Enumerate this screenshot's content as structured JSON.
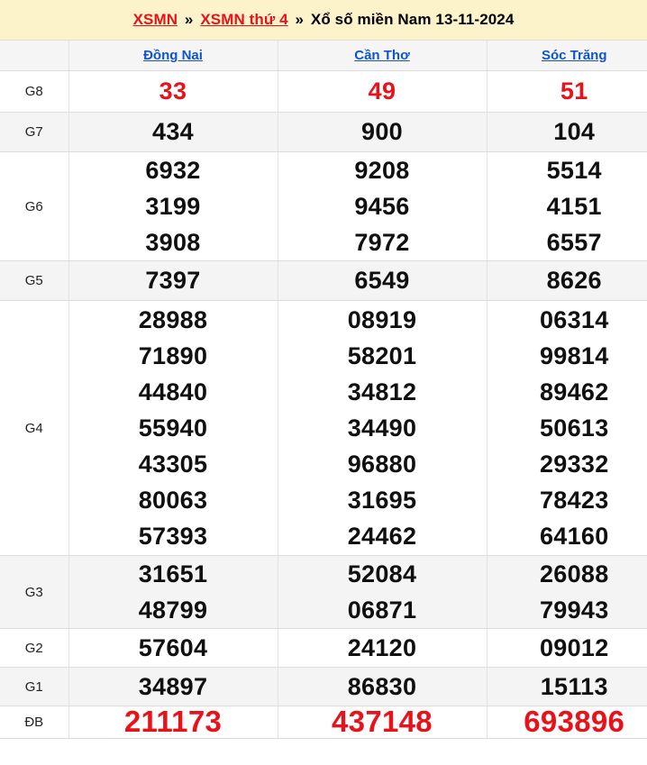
{
  "breadcrumb": {
    "link1": "XSMN",
    "sep1": "»",
    "link2": "XSMN thứ 4",
    "sep2": "»",
    "current": "Xổ số miền Nam 13-11-2024"
  },
  "colors": {
    "header_bg": "#fcf3ca",
    "crumb_link": "#e8121a",
    "province_link": "#1155cc",
    "special_red": "#e8121a",
    "row_grey": "#f4f4f4",
    "row_white": "#ffffff"
  },
  "table": {
    "corner_label": "",
    "columns": [
      "Đồng Nai",
      "Cần Thơ",
      "Sóc Trăng"
    ],
    "rows": [
      {
        "label": "G8",
        "band": "white",
        "style": "red",
        "values": [
          [
            "33"
          ],
          [
            "49"
          ],
          [
            "51"
          ]
        ]
      },
      {
        "label": "G7",
        "band": "grey",
        "style": "normal",
        "values": [
          [
            "434"
          ],
          [
            "900"
          ],
          [
            "104"
          ]
        ]
      },
      {
        "label": "G6",
        "band": "white",
        "style": "normal",
        "values": [
          [
            "6932",
            "3199",
            "3908"
          ],
          [
            "9208",
            "9456",
            "7972"
          ],
          [
            "5514",
            "4151",
            "6557"
          ]
        ]
      },
      {
        "label": "G5",
        "band": "grey",
        "style": "normal",
        "values": [
          [
            "7397"
          ],
          [
            "6549"
          ],
          [
            "8626"
          ]
        ]
      },
      {
        "label": "G4",
        "band": "white",
        "style": "normal",
        "values": [
          [
            "28988",
            "71890",
            "44840",
            "55940",
            "43305",
            "80063",
            "57393"
          ],
          [
            "08919",
            "58201",
            "34812",
            "34490",
            "96880",
            "31695",
            "24462"
          ],
          [
            "06314",
            "99814",
            "89462",
            "50613",
            "29332",
            "78423",
            "64160"
          ]
        ]
      },
      {
        "label": "G3",
        "band": "grey",
        "style": "normal",
        "values": [
          [
            "31651",
            "48799"
          ],
          [
            "52084",
            "06871"
          ],
          [
            "26088",
            "79943"
          ]
        ]
      },
      {
        "label": "G2",
        "band": "white",
        "style": "normal",
        "values": [
          [
            "57604"
          ],
          [
            "24120"
          ],
          [
            "09012"
          ]
        ]
      },
      {
        "label": "G1",
        "band": "grey",
        "style": "normal",
        "values": [
          [
            "34897"
          ],
          [
            "86830"
          ],
          [
            "15113"
          ]
        ]
      },
      {
        "label": "ĐB",
        "band": "white",
        "style": "red-big",
        "values": [
          [
            "211173"
          ],
          [
            "437148"
          ],
          [
            "693896"
          ]
        ]
      }
    ]
  }
}
